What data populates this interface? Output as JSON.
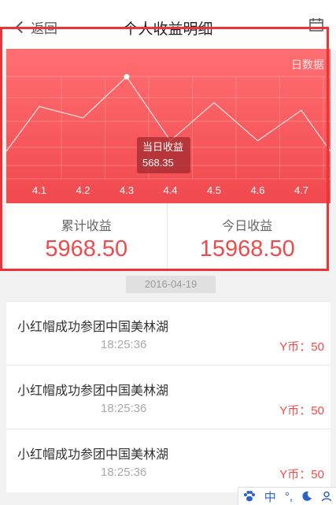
{
  "nav": {
    "back_label": "返回",
    "title": "个人收益明细",
    "calendar_icon": "calendar-icon"
  },
  "chart": {
    "mode_label": "日数据",
    "tooltip_title": "当日收益",
    "tooltip_value": "568.35"
  },
  "chart_data": {
    "type": "line",
    "categories": [
      "4.1",
      "4.2",
      "4.3",
      "4.4",
      "4.5",
      "4.6",
      "4.7"
    ],
    "series": [
      {
        "values": [
          490,
          460,
          568,
          400,
          500,
          400,
          480
        ]
      }
    ],
    "xlabel": "",
    "ylabel": "",
    "ylim": [
      300,
      600
    ],
    "highlight_category": "4.3",
    "grid": true
  },
  "stats": {
    "total_label": "累计收益",
    "total_value": "5968.50",
    "today_label": "今日收益",
    "today_value": "15968.50"
  },
  "date_chip": "2016-04-19",
  "records": [
    {
      "title": "小红帽成功参团中国美林湖",
      "time": "18:25:36",
      "amount": "Y币：50"
    },
    {
      "title": "小红帽成功参团中国美林湖",
      "time": "18:25:36",
      "amount": "Y币：50"
    },
    {
      "title": "小红帽成功参团中国美林湖",
      "time": "18:25:36",
      "amount": "Y币：50"
    }
  ],
  "ime": {
    "paw_icon": "paw-icon",
    "lang": "中",
    "punct": "°,",
    "moon_icon": "moon-icon",
    "user_icon": "user-icon"
  },
  "colors": {
    "accent": "#f04a4a",
    "frame": "#ee3336"
  }
}
